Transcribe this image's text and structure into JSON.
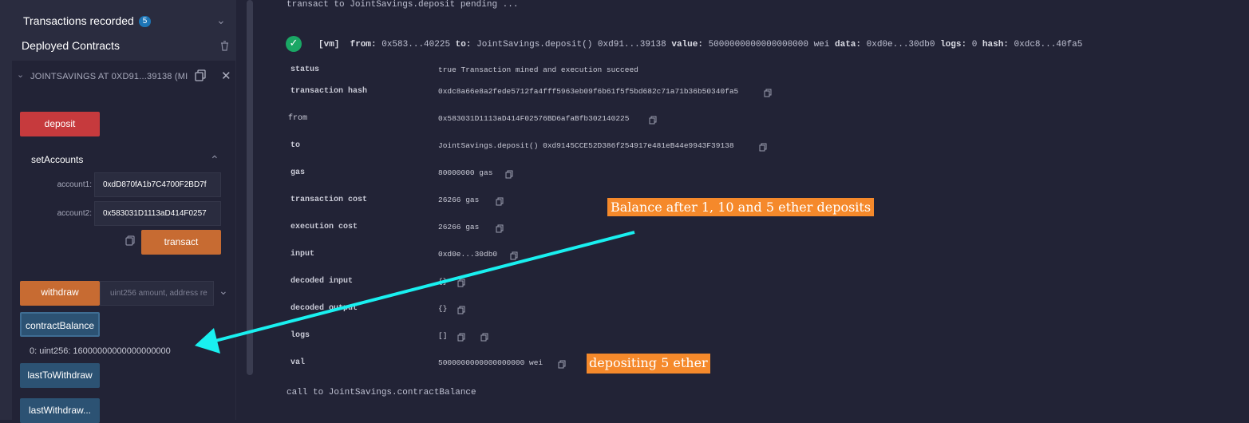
{
  "sidebar": {
    "transactions_label": "Transactions recorded",
    "transactions_count": "5",
    "deployed_label": "Deployed Contracts",
    "contract_title": "JOINTSAVINGS AT 0XD91...39138 (MI",
    "deposit_label": "deposit",
    "set_accounts_label": "setAccounts",
    "account1_label": "account1:",
    "account1_value": "0xdD870fA1b7C4700F2BD7f",
    "account2_label": "account2:",
    "account2_value": "0x583031D1113aD414F0257",
    "transact_label": "transact",
    "withdraw_label": "withdraw",
    "withdraw_placeholder": "uint256 amount, address re",
    "contract_balance_label": "contractBalance",
    "contract_balance_result": "0: uint256: 16000000000000000000",
    "last_to_withdraw_label": "lastToWithdraw",
    "last_withdraw_amount_label": "lastWithdraw..."
  },
  "terminal": {
    "pending_line": "transact to JointSavings.deposit pending ...",
    "summary": {
      "vm": "[vm]",
      "from_label": "from:",
      "from_value": "0x583...40225",
      "to_label": "to:",
      "to_value": "JointSavings.deposit() 0xd91...39138",
      "value_label": "value:",
      "value_value": "5000000000000000000 wei",
      "data_label": "data:",
      "data_value": "0xd0e...30db0",
      "logs_label": "logs:",
      "logs_value": "0",
      "hash_label": "hash:",
      "hash_value": "0xdc8...40fa5"
    },
    "rows": {
      "status_key": "status",
      "status_val": "true Transaction mined and execution succeed",
      "hash_key": "transaction hash",
      "hash_val": "0xdc8a66e8a2fede5712fa4fff5963eb09f6b61f5f5bd682c71a71b36b50340fa5",
      "from_key": "from",
      "from_val": "0x583031D1113aD414F02576BD6afaBfb302140225",
      "to_key": "to",
      "to_val": "JointSavings.deposit() 0xd9145CCE52D386f254917e481eB44e9943F39138",
      "gas_key": "gas",
      "gas_val": "80000000 gas",
      "tx_cost_key": "transaction cost",
      "tx_cost_val": "26266 gas",
      "exec_cost_key": "execution cost",
      "exec_cost_val": "26266 gas",
      "input_key": "input",
      "input_val": "0xd0e...30db0",
      "decoded_input_key": "decoded input",
      "decoded_input_val": "{}",
      "decoded_output_key": "decoded output",
      "decoded_output_val": "{}",
      "logs_key": "logs",
      "logs_val": "[]",
      "val_key": "val",
      "val_val": "5000000000000000000 wei"
    },
    "call_line": "call to JointSavings.contractBalance"
  },
  "annotations": {
    "balance_note": "Balance after 1, 10 and 5 ether deposits",
    "deposit_note": "depositing 5 ether",
    "arrow_color": "#19f0f0",
    "note_color": "#f5892b"
  }
}
